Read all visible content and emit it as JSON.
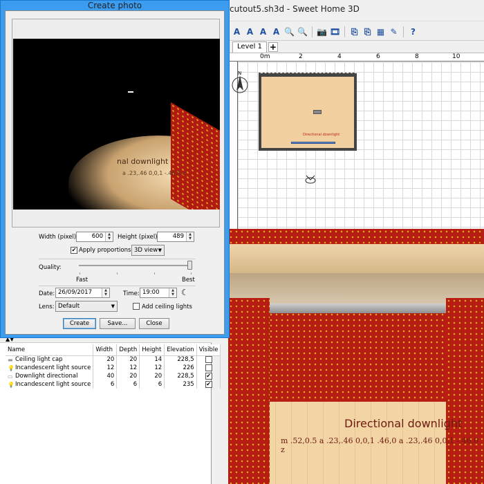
{
  "main_window": {
    "title": "cutout5.sh3d - Sweet Home 3D"
  },
  "plan": {
    "level_tab": "Level 1",
    "add_level": "+",
    "ruler_labels": [
      "0m",
      "2",
      "4",
      "6",
      "8",
      "10"
    ],
    "room_label": "Directional downlight"
  },
  "view3d": {
    "text_line1": "Directional downlight",
    "text_line2": "m .52,0.5 a .23,.46 0,0,1 .46,0 a .23,.46 0,0,1 -.46,0 z"
  },
  "dialog": {
    "title": "Create photo",
    "preview_text1": "nal downlight",
    "preview_text2": "a .23,.46 0,0,1 -.46,0 z",
    "width_label": "Width (pixel):",
    "width_value": "600",
    "height_label": "Height (pixel):",
    "height_value": "489",
    "apply_proportions_label": "Apply proportions:",
    "apply_proportions_checked": "✔",
    "proportions_value": "3D view",
    "quality_label": "Quality:",
    "quality_fast": "Fast",
    "quality_best": "Best",
    "quality_level": 1.0,
    "date_label": "Date:",
    "date_value": "26/09/2017",
    "time_label": "Time:",
    "time_value": "19:00",
    "lens_label": "Lens:",
    "lens_value": "Default",
    "ceiling_lights_label": "Add ceiling lights",
    "create_button": "Create",
    "save_button": "Save...",
    "close_button": "Close"
  },
  "furniture": {
    "columns": [
      "Name",
      "Width",
      "Depth",
      "Height",
      "Elevation",
      "Visible"
    ],
    "rows": [
      {
        "name": "Ceiling light cap",
        "width": "20",
        "depth": "20",
        "height": "14",
        "elevation": "228,5",
        "visible": ""
      },
      {
        "name": "Incandescent light source",
        "width": "12",
        "depth": "12",
        "height": "12",
        "elevation": "226",
        "visible": ""
      },
      {
        "name": "Downlight directional",
        "width": "40",
        "depth": "20",
        "height": "20",
        "elevation": "228,5",
        "visible": "✔"
      },
      {
        "name": "Incandescent light source",
        "width": "6",
        "depth": "6",
        "height": "6",
        "elevation": "235",
        "visible": "✔"
      }
    ]
  },
  "colors": {
    "dialog_frame": "#3c9cf0",
    "brick": "#b71d12",
    "floor": "#f2d4a5"
  }
}
